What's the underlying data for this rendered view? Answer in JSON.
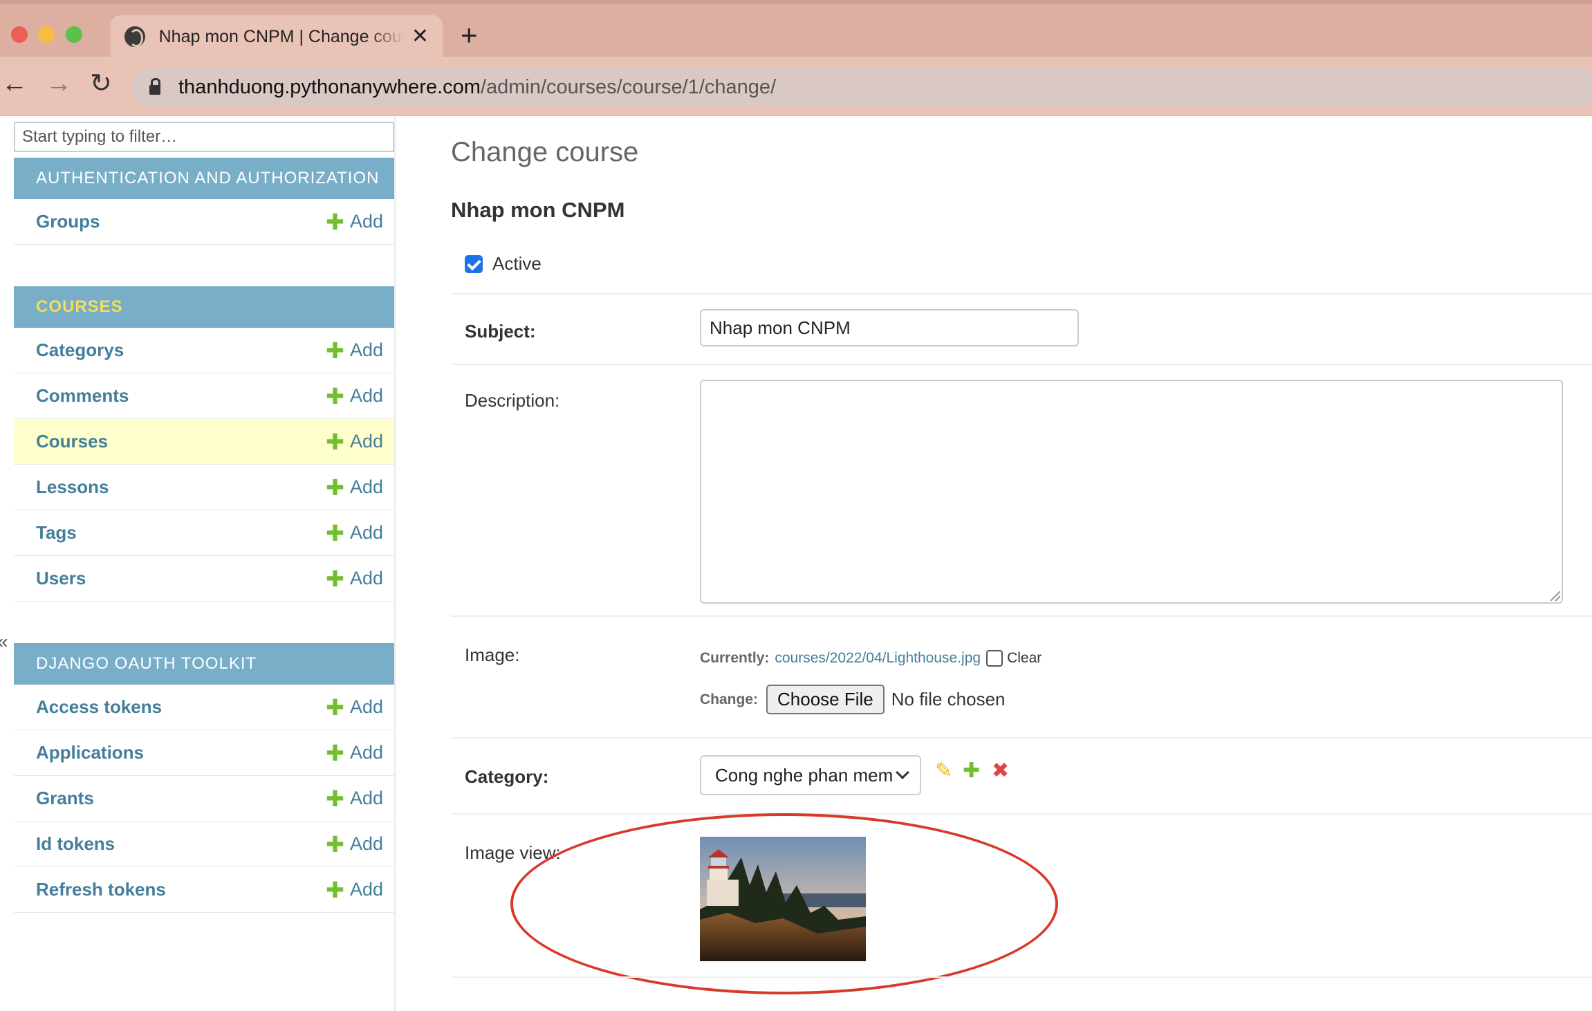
{
  "browser": {
    "tab_title": "Nhap mon CNPM | Change course | Django site admin",
    "tab_close": "✕",
    "new_tab": "+",
    "url_host": "thanhduong.pythonanywhere.com",
    "url_path": "/admin/courses/course/1/change/",
    "back": "←",
    "forward": "→",
    "reload": "↻"
  },
  "sidebar": {
    "filter_placeholder": "Start typing to filter…",
    "collapse": "«",
    "modules": [
      {
        "title": "AUTHENTICATION AND AUTHORIZATION",
        "items": [
          {
            "label": "Groups",
            "add": "Add"
          }
        ]
      },
      {
        "title": "COURSES",
        "items": [
          {
            "label": "Categorys",
            "add": "Add"
          },
          {
            "label": "Comments",
            "add": "Add"
          },
          {
            "label": "Courses",
            "add": "Add"
          },
          {
            "label": "Lessons",
            "add": "Add"
          },
          {
            "label": "Tags",
            "add": "Add"
          },
          {
            "label": "Users",
            "add": "Add"
          }
        ]
      },
      {
        "title": "DJANGO OAUTH TOOLKIT",
        "items": [
          {
            "label": "Access tokens",
            "add": "Add"
          },
          {
            "label": "Applications",
            "add": "Add"
          },
          {
            "label": "Grants",
            "add": "Add"
          },
          {
            "label": "Id tokens",
            "add": "Add"
          },
          {
            "label": "Refresh tokens",
            "add": "Add"
          }
        ]
      }
    ],
    "plus_glyph": "✚"
  },
  "main": {
    "page_title": "Change course",
    "object_title": "Nhap mon CNPM",
    "active_label": "Active",
    "subject_label": "Subject:",
    "subject_value": "Nhap mon CNPM",
    "description_label": "Description:",
    "description_value": "",
    "image_label": "Image:",
    "currently_label": "Currently:",
    "current_file": "courses/2022/04/Lighthouse.jpg",
    "clear_label": "Clear",
    "change_label": "Change:",
    "choose_file": "Choose File",
    "no_file": "No file chosen",
    "category_label": "Category:",
    "category_value": "Cong nghe phan mem",
    "image_view_label": "Image view:"
  },
  "colors": {
    "module_header": "#79aec8",
    "link": "#447e9b",
    "current_row": "#ffffcc",
    "add_plus": "#70bf2b",
    "annotation": "#d63a2a"
  }
}
